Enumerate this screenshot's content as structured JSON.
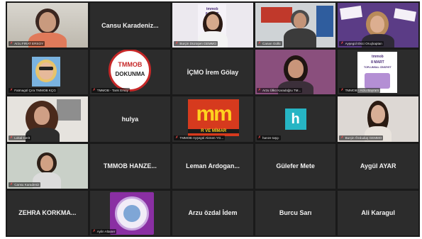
{
  "colors": {
    "active_border": "#9bd24a",
    "muted": "#ff4d4d",
    "tile_bg": "#2c2c2c",
    "grid_bg": "#1a1a1a"
  },
  "participants": [
    {
      "label": "Arzu FIRAT ERSOY",
      "name": "",
      "kind": "video"
    },
    {
      "label": "",
      "name": "Cansu Karadeniz...",
      "kind": "name"
    },
    {
      "label": "Burçin Düzüşen GEMMO",
      "name": "",
      "kind": "video-active",
      "poster_top": "tmmob",
      "poster_mid": "8 MART"
    },
    {
      "label": "Canan Güllü",
      "name": "",
      "kind": "video"
    },
    {
      "label": "Ayşegül Ekici Oruçkaptan",
      "name": "",
      "kind": "video"
    },
    {
      "label": "Fatmagül Çıra TMMOB KÇG",
      "name": "",
      "kind": "video"
    },
    {
      "label": "TMMOB - Tarık Ersoy",
      "name": "",
      "kind": "logo",
      "logo_top": "TMMOB",
      "logo_bottom": "DOKUNMA"
    },
    {
      "label": "",
      "name": "İÇMO İrem Gölay",
      "kind": "name"
    },
    {
      "label": "Arzu Ülkü Karadoğru TM...",
      "name": "",
      "kind": "video"
    },
    {
      "label": "TMMOB - Arzu Bayram",
      "name": "",
      "kind": "poster",
      "poster_top": "tmmob",
      "poster_mid": "8 MART",
      "poster_bottom": "TOPLUMSAL CİNSİYET"
    },
    {
      "label": "Lokal Cerit",
      "name": "",
      "kind": "video"
    },
    {
      "label": "",
      "name": "hulya",
      "kind": "name"
    },
    {
      "label": "TMMOB-Ayşegül Akmen YG...",
      "name": "",
      "kind": "banner",
      "banner_big": "mm",
      "banner_small": "R VE MİMAR"
    },
    {
      "label": "hanze taşçı",
      "name": "",
      "kind": "h",
      "h_letter": "h"
    },
    {
      "label": "Burçin Özduduş GEMMO",
      "name": "",
      "kind": "video"
    },
    {
      "label": "Cansu Karadeniz",
      "name": "",
      "kind": "video"
    },
    {
      "label": "",
      "name": "TMMOB HANZE...",
      "kind": "name"
    },
    {
      "label": "",
      "name": "Leman Ardogan...",
      "kind": "name"
    },
    {
      "label": "",
      "name": "Gülefer Mete",
      "kind": "name"
    },
    {
      "label": "",
      "name": "Aygül AYAR",
      "kind": "name"
    },
    {
      "label": "",
      "name": "ZEHRA KORKMA...",
      "kind": "name"
    },
    {
      "label": "Aylin Altaner",
      "name": "",
      "kind": "seal"
    },
    {
      "label": "",
      "name": "Arzu özdal İdem",
      "kind": "name"
    },
    {
      "label": "",
      "name": "Burcu Sarı",
      "kind": "name"
    },
    {
      "label": "",
      "name": "Ali Karagul",
      "kind": "name"
    }
  ]
}
